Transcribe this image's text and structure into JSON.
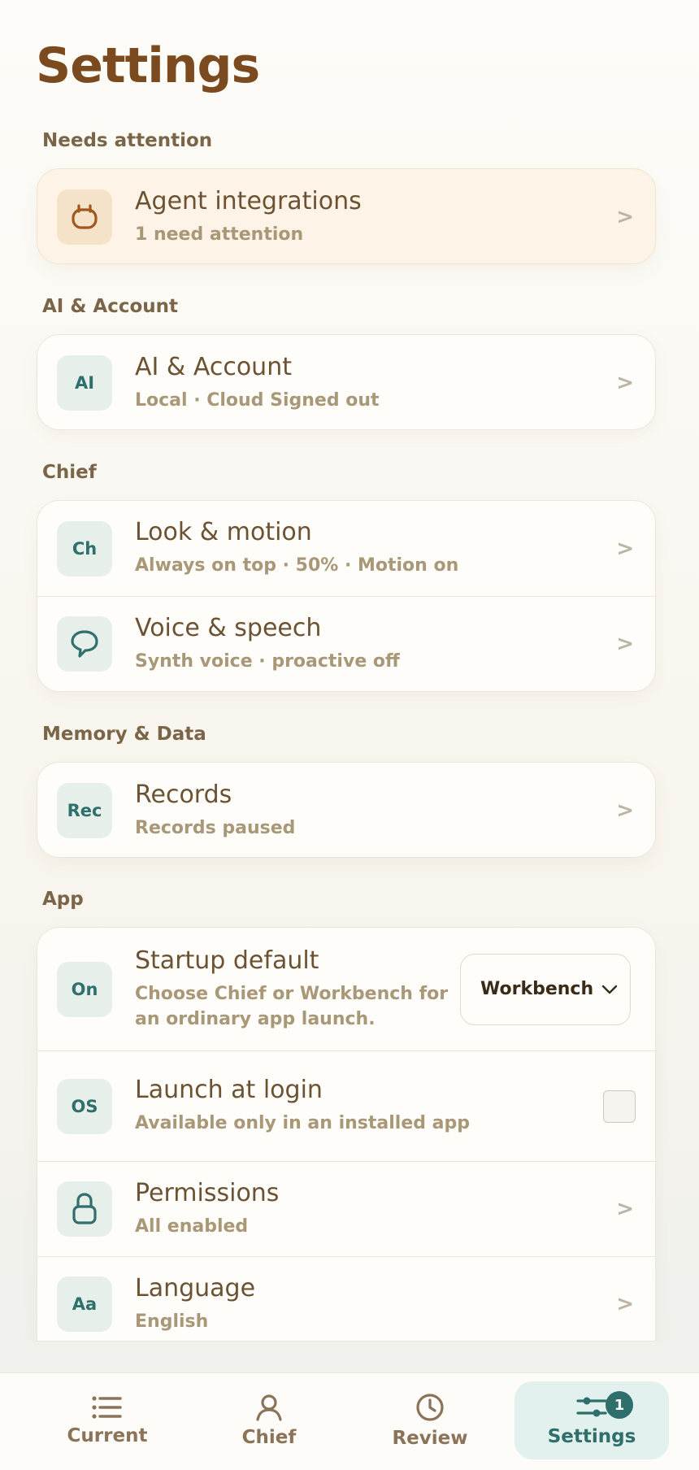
{
  "page": {
    "title": "Settings"
  },
  "sections": {
    "attention": {
      "label": "Needs attention",
      "rows": [
        {
          "icon": "plug-icon",
          "title": "Agent integrations",
          "subtitle": "1 need attention"
        }
      ]
    },
    "ai_account": {
      "label": "AI & Account",
      "rows": [
        {
          "tile": "AI",
          "title": "AI & Account",
          "subtitle": "Local · Cloud Signed out"
        }
      ]
    },
    "chief": {
      "label": "Chief",
      "rows": [
        {
          "tile": "Ch",
          "title": "Look & motion",
          "subtitle": "Always on top · 50% · Motion on"
        },
        {
          "icon": "speech-bubble-icon",
          "title": "Voice & speech",
          "subtitle": "Synth voice · proactive off"
        }
      ]
    },
    "memory": {
      "label": "Memory & Data",
      "rows": [
        {
          "tile": "Rec",
          "title": "Records",
          "subtitle": "Records paused"
        }
      ]
    },
    "app": {
      "label": "App",
      "rows": [
        {
          "tile": "On",
          "title": "Startup default",
          "subtitle": "Choose Chief or Workbench for an ordinary app launch.",
          "select_value": "Workbench"
        },
        {
          "tile": "OS",
          "title": "Launch at login",
          "subtitle": "Available only in an installed app",
          "checked": false
        },
        {
          "icon": "lock-icon",
          "title": "Permissions",
          "subtitle": "All enabled"
        },
        {
          "tile": "Aa",
          "title": "Language",
          "subtitle": "English"
        }
      ]
    }
  },
  "chevron": ">",
  "tabbar": {
    "tabs": [
      {
        "label": "Current",
        "icon": "list-icon",
        "active": false
      },
      {
        "label": "Chief",
        "icon": "person-icon",
        "active": false
      },
      {
        "label": "Review",
        "icon": "clock-icon",
        "active": false
      },
      {
        "label": "Settings",
        "icon": "sliders-icon",
        "active": true,
        "badge": "1"
      }
    ]
  },
  "colors": {
    "accent": "#2e6f6c",
    "title": "#7b4a1e",
    "attention_bg": "#fdf3e6"
  }
}
